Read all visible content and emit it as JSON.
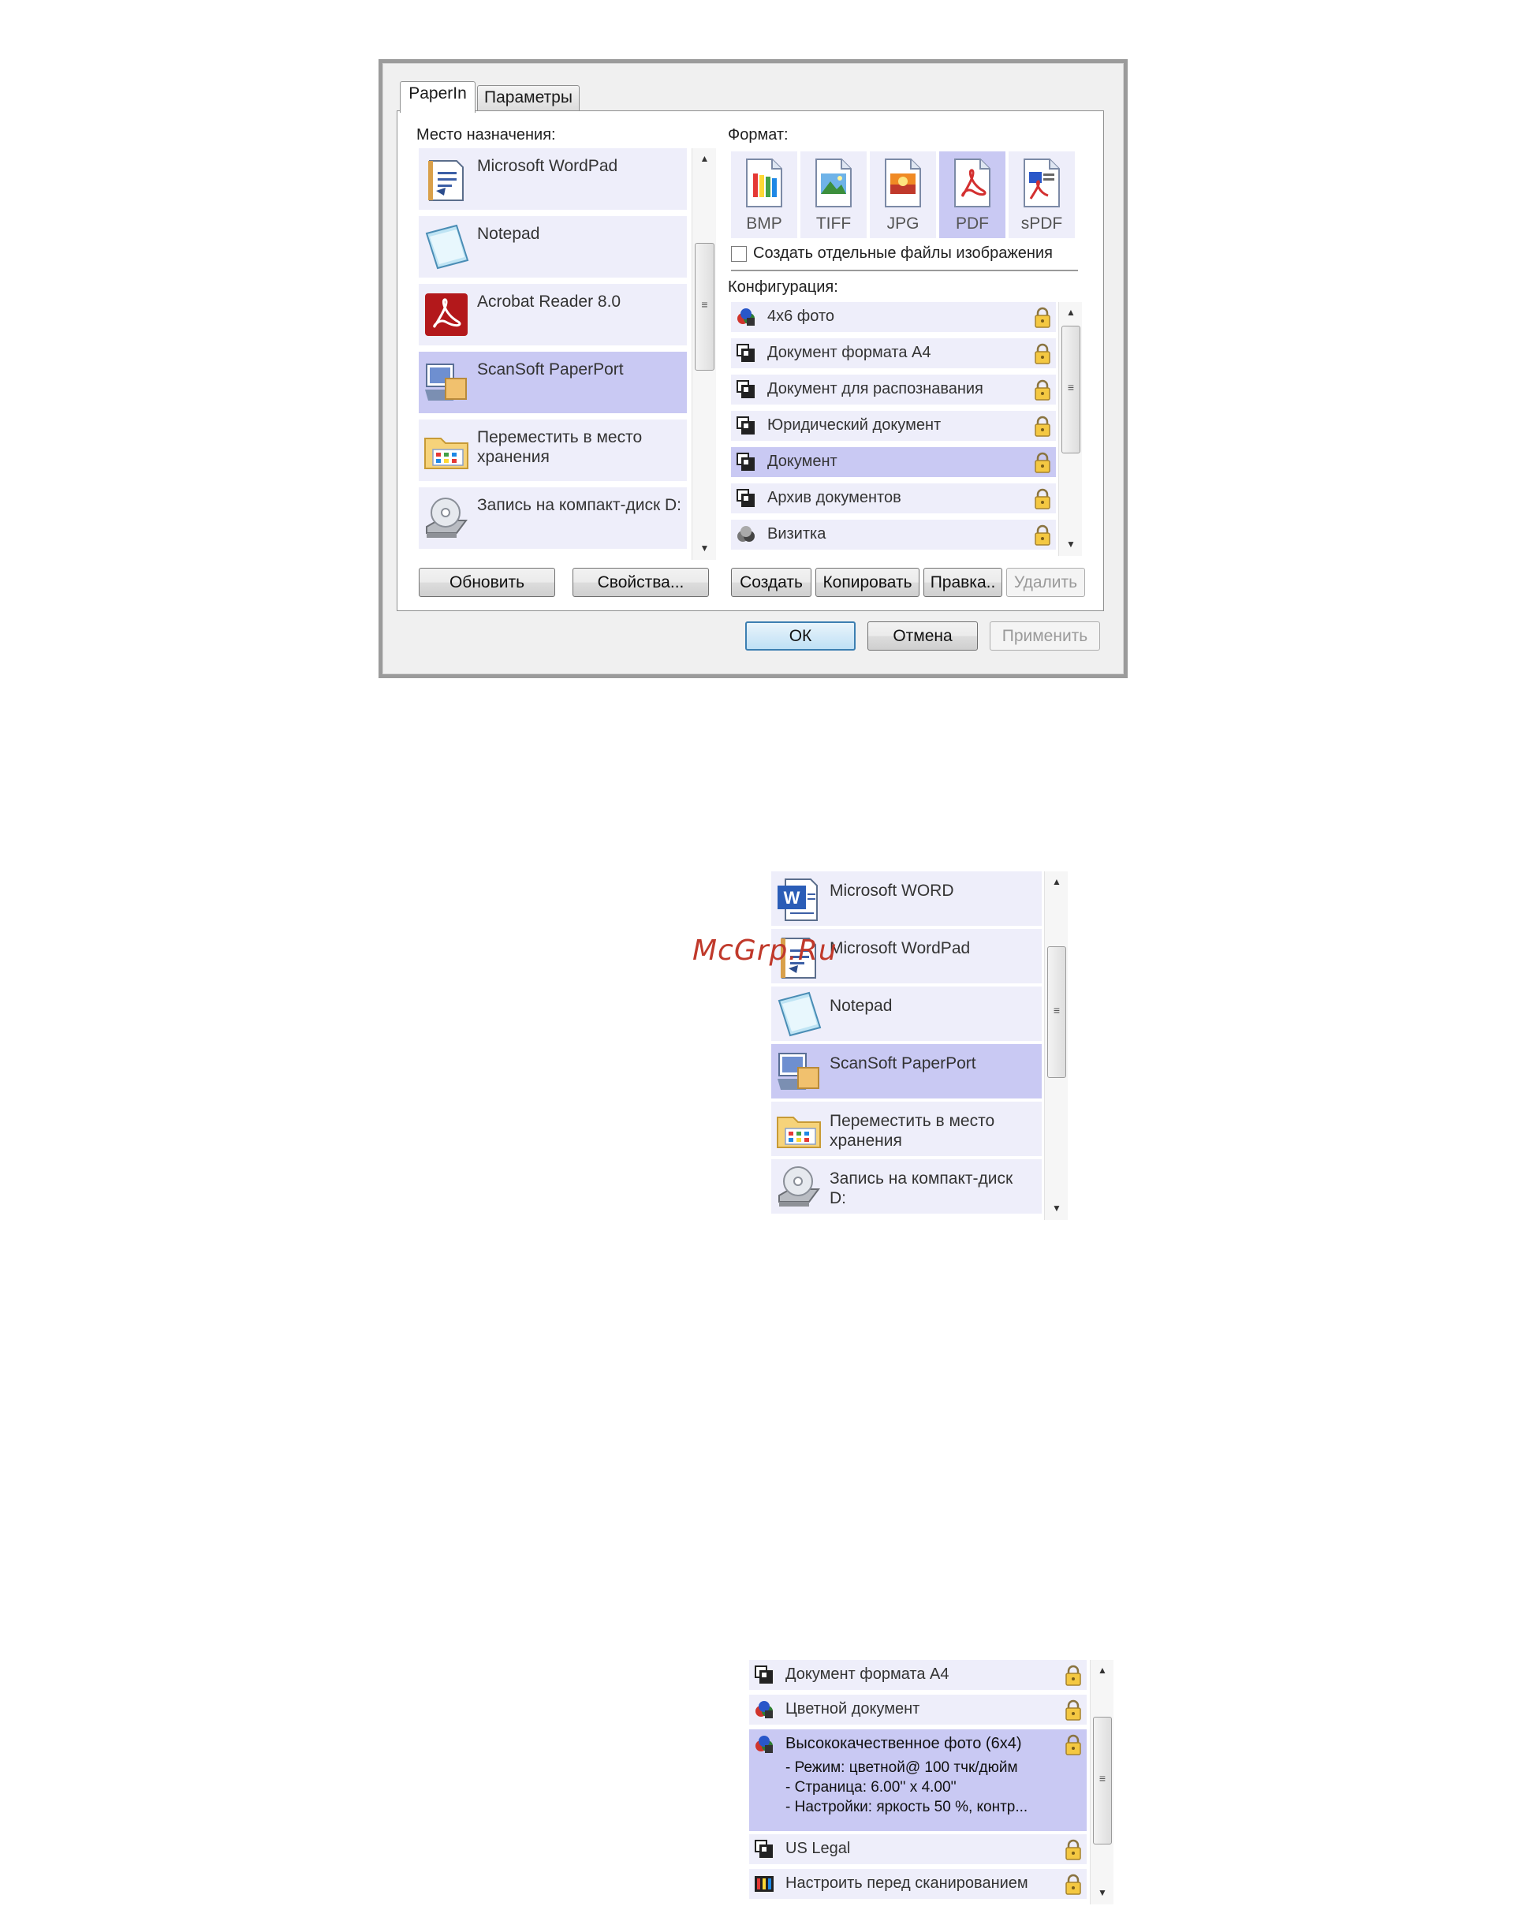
{
  "dialog": {
    "tabs": [
      {
        "label": "PaperIn",
        "active": true
      },
      {
        "label": "Параметры",
        "active": false
      }
    ],
    "destination_label": "Место назначения:",
    "destinations": [
      {
        "label": "Microsoft WordPad",
        "icon": "wordpad-icon"
      },
      {
        "label": "Notepad",
        "icon": "notepad-icon"
      },
      {
        "label": "Acrobat Reader 8.0",
        "icon": "acrobat-icon"
      },
      {
        "label": "ScanSoft PaperPort",
        "icon": "paperport-icon",
        "selected": true
      },
      {
        "label": "Переместить в место хранения",
        "icon": "folder-icon"
      },
      {
        "label": "Запись на компакт-диск D:",
        "icon": "cd-drive-icon"
      }
    ],
    "format_label": "Формат:",
    "formats": [
      {
        "label": "BMP",
        "icon": "bmp-file-icon"
      },
      {
        "label": "TIFF",
        "icon": "tiff-file-icon"
      },
      {
        "label": "JPG",
        "icon": "jpg-file-icon"
      },
      {
        "label": "PDF",
        "icon": "pdf-file-icon",
        "selected": true
      },
      {
        "label": "sPDF",
        "icon": "spdf-file-icon"
      }
    ],
    "separate_files_label": "Создать отдельные файлы изображения",
    "config_label": "Конфигурация:",
    "configs": [
      {
        "label": "4x6 фото",
        "icon": "color-config-icon"
      },
      {
        "label": "Документ формата А4",
        "icon": "bw-config-icon"
      },
      {
        "label": "Документ для распознавания",
        "icon": "bw-config-icon"
      },
      {
        "label": "Юридический документ",
        "icon": "bw-config-icon"
      },
      {
        "label": "Документ",
        "icon": "bw-config-icon",
        "selected": true
      },
      {
        "label": "Архив документов",
        "icon": "bw-config-icon"
      },
      {
        "label": "Визитка",
        "icon": "gray-config-icon"
      }
    ],
    "buttons": {
      "refresh": "Обновить",
      "properties": "Свойства...",
      "create": "Создать",
      "copy": "Копировать",
      "edit": "Правка..",
      "delete": "Удалить",
      "ok": "ОК",
      "cancel": "Отмена",
      "apply": "Применить"
    }
  },
  "list2": {
    "items": [
      {
        "label": "Microsoft WORD",
        "icon": "word-icon"
      },
      {
        "label": "Microsoft WordPad",
        "icon": "wordpad-icon"
      },
      {
        "label": "Notepad",
        "icon": "notepad-icon"
      },
      {
        "label": "ScanSoft PaperPort",
        "icon": "paperport-icon",
        "selected": true
      },
      {
        "label": "Переместить в место хранения",
        "icon": "folder-icon"
      },
      {
        "label": "Запись на компакт-диск D:",
        "icon": "cd-drive-icon"
      }
    ]
  },
  "watermark": "McGrp.Ru",
  "list3": {
    "items": [
      {
        "label": "Документ формата А4",
        "icon": "bw-config-icon"
      },
      {
        "label": "Цветной документ",
        "icon": "color-config-icon"
      },
      {
        "label": "Высококачественное фото (6x4)",
        "icon": "color-config-icon",
        "selected": true
      },
      {
        "label": "US Legal",
        "icon": "bw-config-icon"
      },
      {
        "label": "Настроить перед сканированием",
        "icon": "configure-before-scan-icon"
      }
    ],
    "details": [
      "- Режим: цветной@ 100 тчк/дюйм",
      "- Страница:  6.00'' x  4.00''",
      "- Настройки: яркость 50 %, контр..."
    ]
  }
}
